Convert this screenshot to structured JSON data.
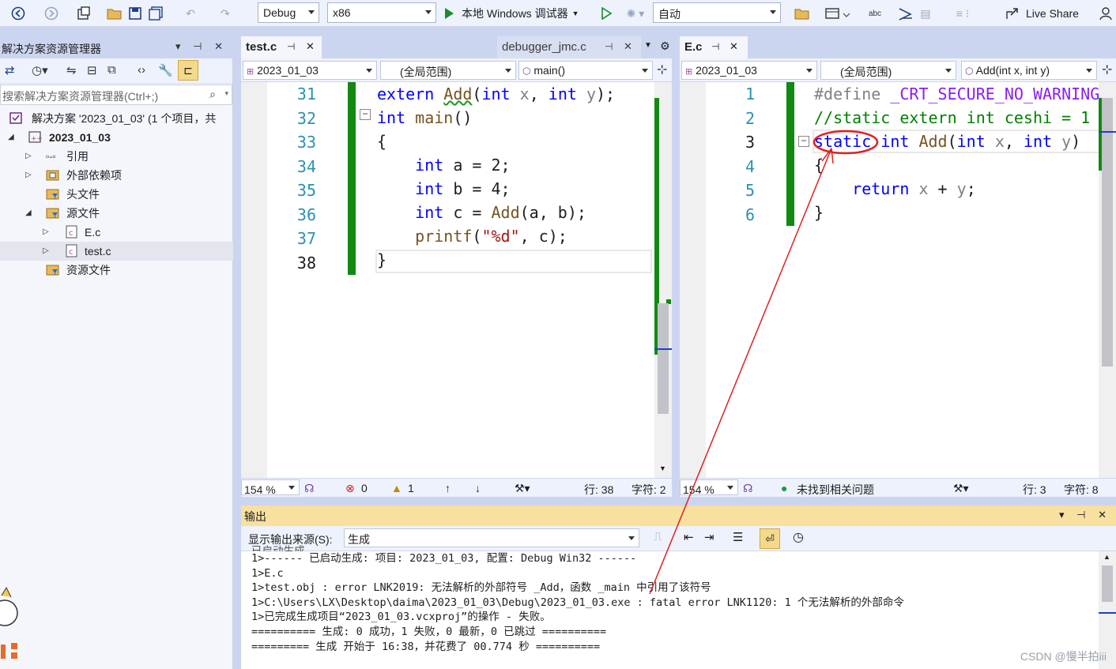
{
  "toolbar": {
    "config": "Debug",
    "platform": "x86",
    "debug_label": "本地 Windows 调试器",
    "auto": "自动",
    "live_share": "Live Share"
  },
  "solution_explorer": {
    "title": "解决方案资源管理器",
    "search_placeholder": "搜索解决方案资源管理器(Ctrl+;)",
    "items": [
      {
        "label": "解决方案 '2023_01_03' (1 个项目，共"
      },
      {
        "label": "2023_01_03"
      },
      {
        "label": "引用"
      },
      {
        "label": "外部依赖项"
      },
      {
        "label": "头文件"
      },
      {
        "label": "源文件"
      },
      {
        "label": "E.c"
      },
      {
        "label": "test.c"
      },
      {
        "label": "资源文件"
      }
    ]
  },
  "left_editor": {
    "tabs": [
      "test.c",
      "debugger_jmc.c"
    ],
    "nav": [
      "2023_01_03",
      "(全局范围)",
      "main()"
    ],
    "line_numbers": [
      "31",
      "32",
      "33",
      "34",
      "35",
      "36",
      "37",
      "38"
    ],
    "zoom": "154 %",
    "errors": "0",
    "warnings": "1",
    "line": "行: 38",
    "col": "字符: 2"
  },
  "right_editor": {
    "tab": "E.c",
    "nav": [
      "2023_01_03",
      "(全局范围)",
      "Add(int x, int y)"
    ],
    "line_numbers": [
      "1",
      "2",
      "3",
      "4",
      "5",
      "6"
    ],
    "zoom": "154 %",
    "issues": "未找到相关问题",
    "line": "行: 3",
    "col": "字符: 8"
  },
  "output": {
    "title": "输出",
    "source_label": "显示输出来源(S):",
    "source_value": "生成",
    "lines": [
      "已启动生成...",
      "1>------ 已启动生成: 项目: 2023_01_03, 配置: Debug Win32 ------",
      "1>E.c",
      "1>test.obj : error LNK2019: 无法解析的外部符号 _Add，函数 _main 中引用了该符号",
      "1>C:\\Users\\LX\\Desktop\\daima\\2023_01_03\\Debug\\2023_01_03.exe : fatal error LNK1120: 1 个无法解析的外部命令",
      "1>已完成生成项目“2023_01_03.vcxproj”的操作 - 失败。",
      "========== 生成: 0 成功，1 失败，0 最新，0 已跳过 ==========",
      "========= 生成 开始于 16:38，并花费了 00.774 秒 =========="
    ]
  },
  "watermark": "CSDN @慢半拍iii",
  "colors": {
    "accent": "#1e3f8a",
    "green_bar": "#108a10",
    "annotation": "#e02020"
  }
}
